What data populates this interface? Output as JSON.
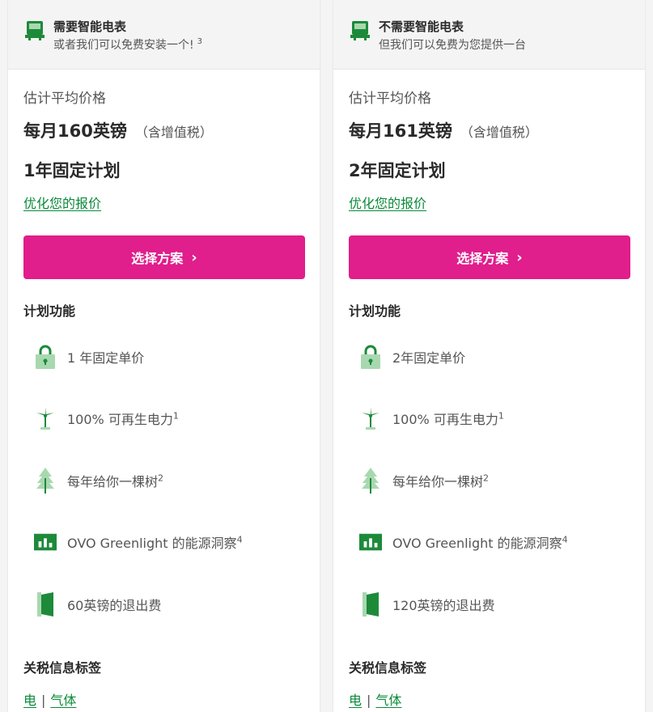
{
  "colors": {
    "accent": "#e01e8c",
    "green": "#0a8a3a",
    "icon_green": "#1d8a3a",
    "icon_light_green": "#a8d8b0"
  },
  "plans": [
    {
      "banner_title": "需要智能电表",
      "banner_sub": "或者我们可以免费安装一个!",
      "banner_sup": "3",
      "est_label": "估计平均价格",
      "price": "每月160英镑",
      "vat": "（含增值税）",
      "plan_name": "1年固定计划",
      "optimize": "优化您的报价",
      "button": "选择方案",
      "features_title": "计划功能",
      "features": [
        {
          "icon": "padlock-icon",
          "text": "1 年固定单价",
          "sup": ""
        },
        {
          "icon": "wind-turbine-icon",
          "text": "100% 可再生电力",
          "sup": "1"
        },
        {
          "icon": "tree-icon",
          "text": "每年给你一棵树",
          "sup": "2"
        },
        {
          "icon": "bar-chart-icon",
          "text": "OVO Greenlight 的能源洞察",
          "sup": "4"
        },
        {
          "icon": "door-exit-icon",
          "text": "60英镑的退出费",
          "sup": ""
        }
      ],
      "tariff_title": "关税信息标签",
      "tariff_links": [
        "电",
        "气体"
      ]
    },
    {
      "banner_title": "不需要智能电表",
      "banner_sub": "但我们可以免费为您提供一台",
      "banner_sup": "",
      "est_label": "估计平均价格",
      "price": "每月161英镑",
      "vat": "（含增值税）",
      "plan_name": "2年固定计划",
      "optimize": "优化您的报价",
      "button": "选择方案",
      "features_title": "计划功能",
      "features": [
        {
          "icon": "padlock-icon",
          "text": "2年固定单价",
          "sup": ""
        },
        {
          "icon": "wind-turbine-icon",
          "text": "100% 可再生电力",
          "sup": "1"
        },
        {
          "icon": "tree-icon",
          "text": "每年给你一棵树",
          "sup": "2"
        },
        {
          "icon": "bar-chart-icon",
          "text": "OVO Greenlight 的能源洞察",
          "sup": "4"
        },
        {
          "icon": "door-exit-icon",
          "text": "120英镑的退出费",
          "sup": ""
        }
      ],
      "tariff_title": "关税信息标签",
      "tariff_links": [
        "电",
        "气体"
      ]
    }
  ]
}
